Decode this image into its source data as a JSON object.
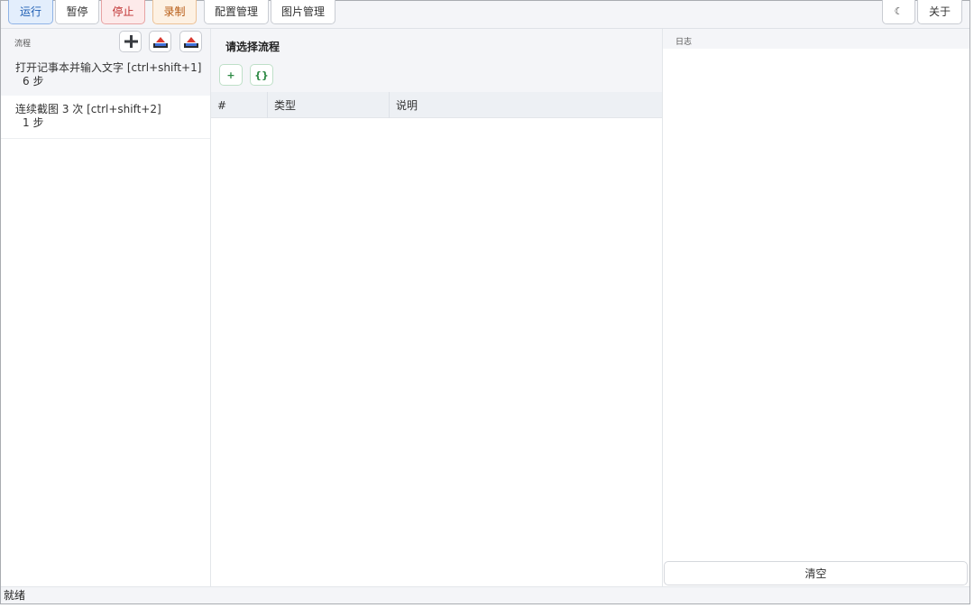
{
  "toolbar": {
    "run": "运行",
    "pause": "暂停",
    "stop": "停止",
    "record": "录制",
    "config": "配置管理",
    "images": "图片管理",
    "theme": "☾",
    "about": "关于"
  },
  "flows": {
    "header": "流程",
    "items": [
      {
        "name": "打开记事本并输入文字 [ctrl+shift+1]",
        "steps": "6 步"
      },
      {
        "name": "连续截图 3 次 [ctrl+shift+2]",
        "steps": "1 步"
      }
    ]
  },
  "editor": {
    "title": "请选择流程",
    "add_label": "+",
    "json_label": "{}",
    "columns": [
      "#",
      "类型",
      "说明"
    ]
  },
  "log": {
    "header": "日志",
    "clear": "清空"
  },
  "status": {
    "text": "就绪"
  },
  "colors": {
    "run": "#1f5fb4",
    "stop": "#c03333",
    "record": "#b75a12",
    "accent_green": "#2e8a45"
  }
}
